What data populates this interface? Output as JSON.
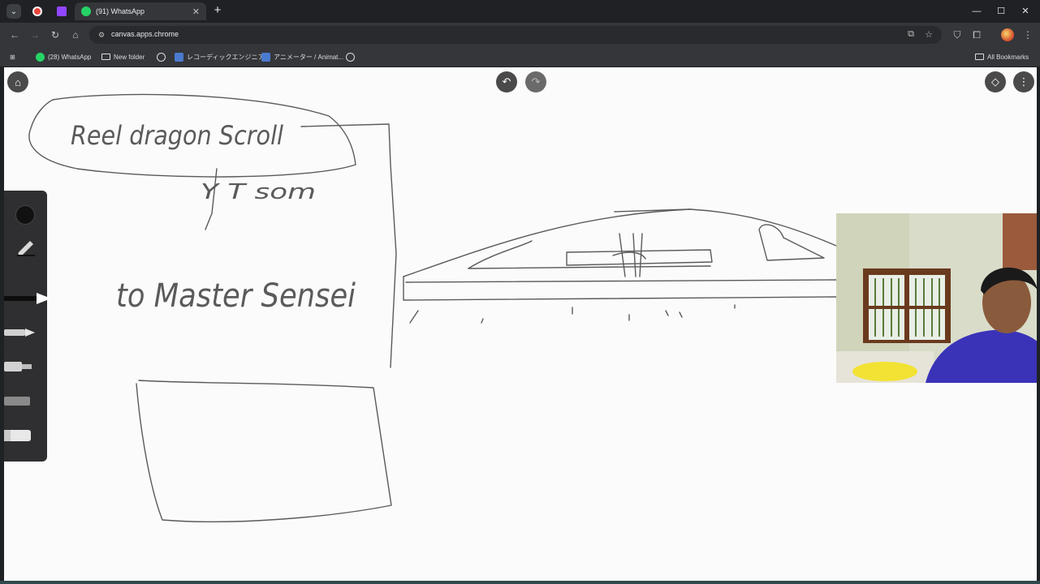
{
  "browser": {
    "tabs": [
      {
        "title": "",
        "icon": "red-record-icon",
        "pinned": true
      },
      {
        "title": "",
        "icon": "twitch-icon",
        "pinned": true
      },
      {
        "title": "(91) WhatsApp",
        "icon": "whatsapp-icon",
        "active": true
      }
    ],
    "url": "canvas.apps.chrome",
    "bookmarks": [
      {
        "label": "(28) WhatsApp",
        "icon": "whatsapp-icon"
      },
      {
        "label": "New folder",
        "icon": "folder-icon"
      },
      {
        "label": "",
        "icon": "globe-icon"
      },
      {
        "label": "レコーディックエンジニア...",
        "icon": "site-icon"
      },
      {
        "label": "アニメーター / Animat...",
        "icon": "site-icon"
      },
      {
        "label": "",
        "icon": "globe-icon"
      }
    ],
    "all_bookmarks_label": "All Bookmarks"
  },
  "canvas": {
    "handwriting": {
      "title_in_oval": "Reel dragon Scroll",
      "under_oval": "Y T som",
      "middle_line": "to Master Sensei"
    },
    "colors": {
      "ink": "#555555",
      "palette_bg": "#2f2f31",
      "active_color": "#111111"
    },
    "palette_tools": [
      "color-swatch",
      "pencil-tool",
      "marker-tool",
      "pen-tool",
      "highlighter-tool",
      "chalk-tool",
      "eraser-tool"
    ],
    "top_buttons": [
      "home",
      "undo",
      "redo",
      "layers",
      "more"
    ]
  }
}
